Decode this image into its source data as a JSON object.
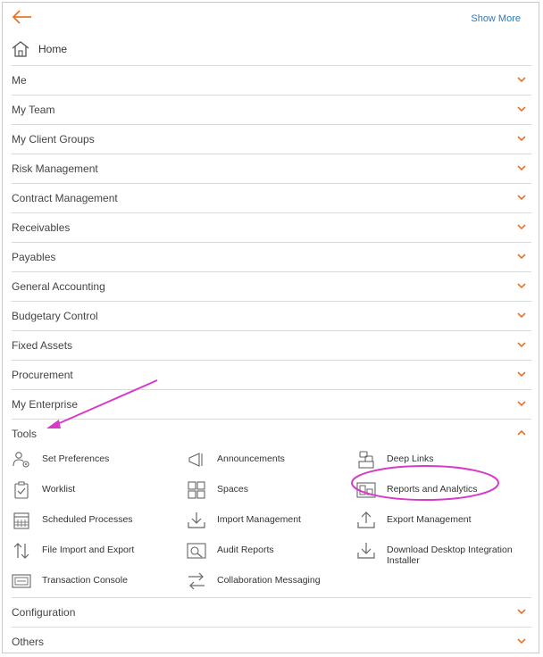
{
  "topbar": {
    "show_more": "Show More"
  },
  "home": {
    "label": "Home"
  },
  "groups_top": [
    {
      "label": "Me"
    },
    {
      "label": "My Team"
    },
    {
      "label": "My Client Groups"
    },
    {
      "label": "Risk Management"
    },
    {
      "label": "Contract Management"
    },
    {
      "label": "Receivables"
    },
    {
      "label": "Payables"
    },
    {
      "label": "General Accounting"
    },
    {
      "label": "Budgetary Control"
    },
    {
      "label": "Fixed Assets"
    },
    {
      "label": "Procurement"
    },
    {
      "label": "My Enterprise"
    }
  ],
  "tools": {
    "label": "Tools",
    "expanded": true,
    "items": [
      {
        "label": "Set Preferences",
        "icon": "preferences-icon"
      },
      {
        "label": "Announcements",
        "icon": "announcements-icon"
      },
      {
        "label": "Deep Links",
        "icon": "deep-links-icon"
      },
      {
        "label": "Worklist",
        "icon": "worklist-icon"
      },
      {
        "label": "Spaces",
        "icon": "spaces-icon"
      },
      {
        "label": "Reports and Analytics",
        "icon": "reports-icon"
      },
      {
        "label": "Scheduled Processes",
        "icon": "calendar-icon"
      },
      {
        "label": "Import Management",
        "icon": "import-icon"
      },
      {
        "label": "Export Management",
        "icon": "export-icon"
      },
      {
        "label": "File Import and Export",
        "icon": "file-transfer-icon"
      },
      {
        "label": "Audit Reports",
        "icon": "audit-icon"
      },
      {
        "label": "Download Desktop Integration Installer",
        "icon": "download-icon"
      },
      {
        "label": "Transaction Console",
        "icon": "console-icon"
      },
      {
        "label": "Collaboration Messaging",
        "icon": "messaging-icon"
      }
    ]
  },
  "groups_bottom": [
    {
      "label": "Configuration"
    },
    {
      "label": "Others"
    }
  ],
  "colors": {
    "accent": "#e8742a",
    "link": "#2a7bbf",
    "highlight": "#d63cc8"
  }
}
